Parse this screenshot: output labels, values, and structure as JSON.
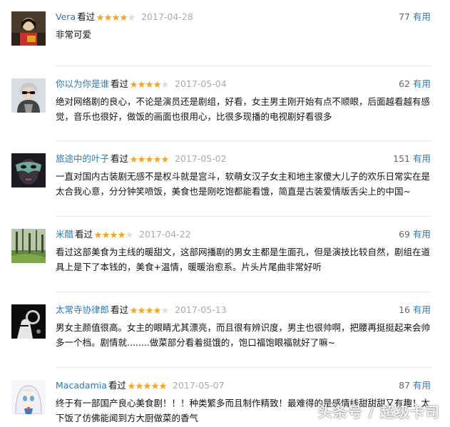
{
  "verb": "看过",
  "useful_label": "有用",
  "colors": {
    "link": "#3377aa",
    "star": "#f5a623",
    "star_empty": "#dddddd",
    "date": "#aaaaaa"
  },
  "reviews": [
    {
      "user": "Vera",
      "stars": 4,
      "date": "2017-04-28",
      "votes": "77",
      "content": "非常可爱",
      "avatar_icon": "girl-portrait-avatar-icon"
    },
    {
      "user": "你以为你是谁",
      "stars": 4,
      "date": "2017-05-04",
      "votes": "62",
      "content": "绝对网络剧的良心，不论是演员还是剧组，好看，女主男主刚开始有点不顺眼，后面越看越有感觉，音乐也很好，做饭的画面也很用心，比很多现播的电视剧好看很多",
      "avatar_icon": "sunglasses-woman-avatar-icon"
    },
    {
      "user": "旅途中的叶子",
      "stars": 5,
      "date": "2017-05-02",
      "votes": "151",
      "content": "一直对国内古装剧无感不是权斗就是宫斗，软萌女汉子女主和地主家傻大儿子的欢乐日常实在是太合我心意，分分钟笑喷饭，美食也是刚吃饱都能看饿，简直是古装爱情版舌尖上的中国~",
      "avatar_icon": "masked-face-avatar-icon"
    },
    {
      "user": "米醋",
      "stars": 4,
      "date": "2017-04-22",
      "votes": "69",
      "content": "看过这部美食为主线的暖甜文，这部网播剧的男女主都是生面孔，但是演技比较自然，剧组在道具上是下了本钱的，美食+温情，暖暖治愈系。片头片尾曲非常好听",
      "avatar_icon": "forest-landscape-avatar-icon"
    },
    {
      "user": "太常寺协律郎",
      "stars": 4,
      "date": "2017-05-13",
      "votes": "16",
      "content": "男女主颜值很高。女主的眼睛尤其漂亮，而且很有辨识度，男主也很帅啊，把腰再挺挺起来会帅多一个档。剧情就........做菜部分看着挺饿的，饱口福饱眼福就好了嘛~",
      "avatar_icon": "dark-illustration-avatar-icon"
    },
    {
      "user": "Macadamia",
      "stars": 5,
      "date": "2017-05-07",
      "votes": "87",
      "content": "终于有一部国产良心美食剧！！！种类繁多而且制作精致！最难得的是感情线甜甜甜又有趣！太下饭了仿佛能闻到方大厨做菜的香气",
      "avatar_icon": "anime-girl-avatar-icon"
    }
  ],
  "watermark": "头条号 / 超级卡司"
}
